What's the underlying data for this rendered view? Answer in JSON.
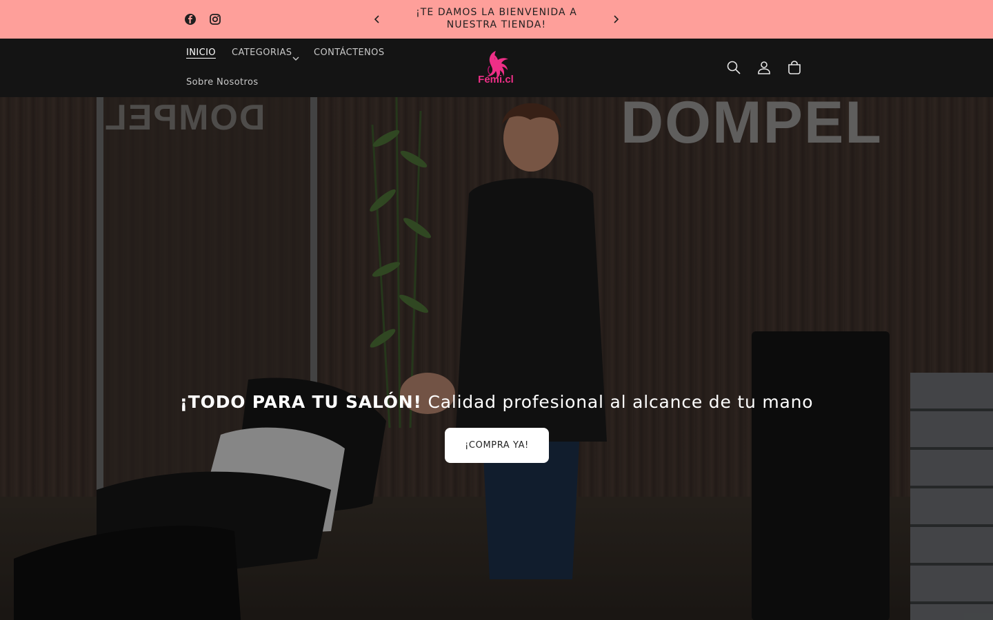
{
  "announcement": {
    "text": "¡TE DAMOS LA BIENVENIDA A NUESTRA TIENDA!",
    "background": "#fe9f9a"
  },
  "social": {
    "icons": [
      "facebook-icon",
      "instagram-icon"
    ]
  },
  "nav": {
    "items": [
      {
        "label": "INICIO",
        "active": true
      },
      {
        "label": "CATEGORIAS",
        "dropdown": true
      },
      {
        "label": "CONTÁCTENOS"
      },
      {
        "label": "Sobre Nosotros"
      }
    ]
  },
  "logo": {
    "text": "Femi.cl",
    "color": "#ee2f87"
  },
  "header_icons": [
    "search-icon",
    "account-icon",
    "cart-icon"
  ],
  "hero": {
    "title_bold": "¡TODO PARA TU SALÓN!",
    "title_rest": " Calidad profesional al alcance de tu mano",
    "cta_label": "¡COMPRA YA!",
    "backdrop_sign_text": "DOMPEL"
  }
}
